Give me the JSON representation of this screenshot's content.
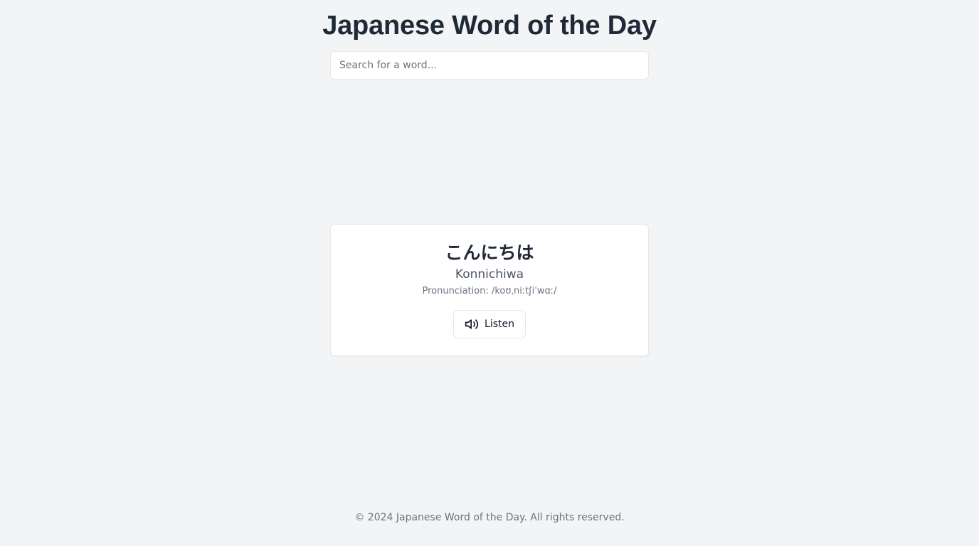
{
  "header": {
    "title": "Japanese Word of the Day"
  },
  "search": {
    "placeholder": "Search for a word...",
    "value": ""
  },
  "word": {
    "japanese": "こんにちは",
    "romaji": "Konnichiwa",
    "pronunciation": "Pronunciation: /koʊˌniːtʃiˈwɑː/",
    "listen_label": "Listen",
    "listen_icon": "speaker-icon"
  },
  "footer": {
    "text": "© 2024 Japanese Word of the Day. All rights reserved."
  },
  "colors": {
    "background": "#f3f4f6",
    "card": "#ffffff",
    "border": "#e5e7eb",
    "title": "#1f2937",
    "muted": "#6b7280"
  }
}
